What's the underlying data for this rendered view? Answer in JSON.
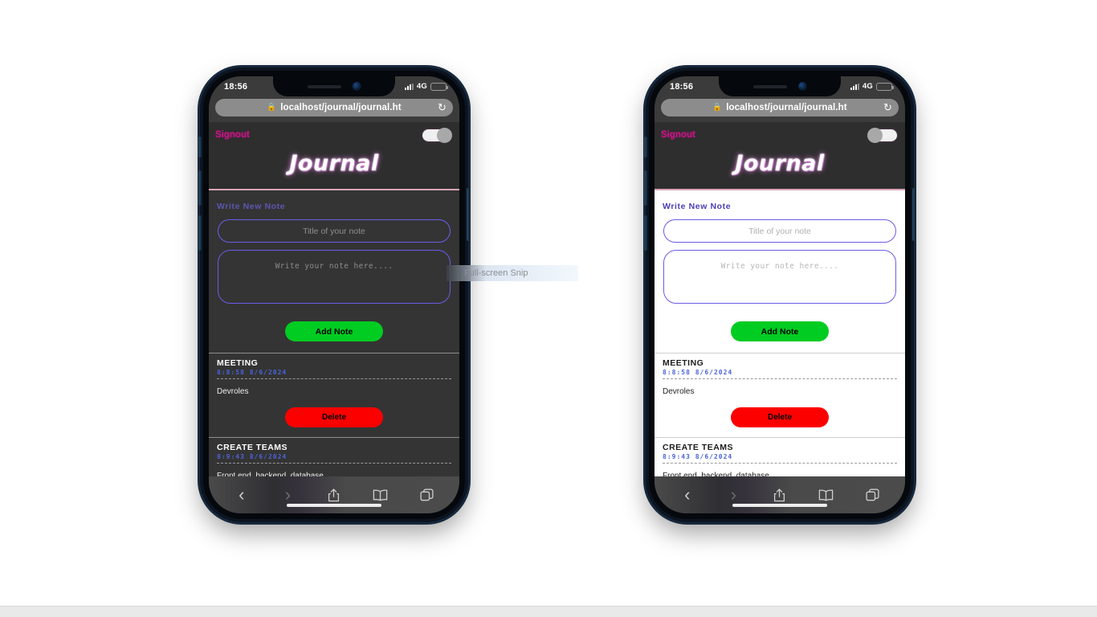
{
  "overlay": {
    "snip_tooltip": "Full-screen Snip"
  },
  "phones": [
    {
      "id": "dark",
      "theme": "dark",
      "status_bar": {
        "time": "18:56",
        "network": "4G",
        "signal_icon": "signal-bars-icon",
        "battery_icon": "battery-icon"
      },
      "browser": {
        "url": "localhost/journal/journal.ht",
        "lock_icon": "lock-icon",
        "reload_icon": "reload-icon",
        "toolbar": [
          {
            "name": "back-button",
            "icon": "chevron-left-icon",
            "glyph": "‹",
            "enabled": true
          },
          {
            "name": "forward-button",
            "icon": "chevron-right-icon",
            "glyph": "›",
            "enabled": false
          },
          {
            "name": "share-button",
            "icon": "share-icon",
            "glyph": "share",
            "enabled": true
          },
          {
            "name": "bookmarks-button",
            "icon": "book-icon",
            "glyph": "book",
            "enabled": true
          },
          {
            "name": "tabs-button",
            "icon": "tabs-icon",
            "glyph": "tabs",
            "enabled": true
          }
        ]
      },
      "app": {
        "signout_label": "Signout",
        "theme_toggle": {
          "state": "on",
          "name": "theme-toggle"
        },
        "title": "Journal",
        "section_label": "Write New Note",
        "title_placeholder": "Title of your note",
        "title_value": "",
        "note_placeholder": "Write your note here....",
        "note_value": "",
        "add_button_label": "Add Note",
        "delete_button_label": "Delete",
        "notes": [
          {
            "title": "MEETING",
            "time": "8:8:58 8/6/2024",
            "body": "Devroles"
          },
          {
            "title": "CREATE TEAMS",
            "time": "8:9:43 8/6/2024",
            "body": "Front end, backend, database"
          }
        ]
      }
    },
    {
      "id": "light",
      "theme": "light",
      "status_bar": {
        "time": "18:56",
        "network": "4G",
        "signal_icon": "signal-bars-icon",
        "battery_icon": "battery-icon"
      },
      "browser": {
        "url": "localhost/journal/journal.ht",
        "lock_icon": "lock-icon",
        "reload_icon": "reload-icon",
        "toolbar": [
          {
            "name": "back-button",
            "icon": "chevron-left-icon",
            "glyph": "‹",
            "enabled": true
          },
          {
            "name": "forward-button",
            "icon": "chevron-right-icon",
            "glyph": "›",
            "enabled": false
          },
          {
            "name": "share-button",
            "icon": "share-icon",
            "glyph": "share",
            "enabled": true
          },
          {
            "name": "bookmarks-button",
            "icon": "book-icon",
            "glyph": "book",
            "enabled": true
          },
          {
            "name": "tabs-button",
            "icon": "tabs-icon",
            "glyph": "tabs",
            "enabled": true
          }
        ]
      },
      "app": {
        "signout_label": "Signout",
        "theme_toggle": {
          "state": "off",
          "name": "theme-toggle"
        },
        "title": "Journal",
        "section_label": "Write New Note",
        "title_placeholder": "Title of your note",
        "title_value": "",
        "note_placeholder": "Write your note here....",
        "note_value": "",
        "add_button_label": "Add Note",
        "delete_button_label": "Delete",
        "notes": [
          {
            "title": "MEETING",
            "time": "8:8:58 8/6/2024",
            "body": "Devroles"
          },
          {
            "title": "CREATE TEAMS",
            "time": "8:9:43 8/6/2024",
            "body": "Front end, backend, database"
          }
        ]
      }
    }
  ],
  "colors": {
    "accent_green": "#00cc22",
    "accent_red": "#fc0000",
    "accent_purple": "#6b5ce7",
    "signout_pink": "#c71585",
    "time_blue": "#4a63d8",
    "dark_bg": "#343434",
    "light_bg": "#ffffff",
    "header_bg": "#2e2e2e"
  }
}
